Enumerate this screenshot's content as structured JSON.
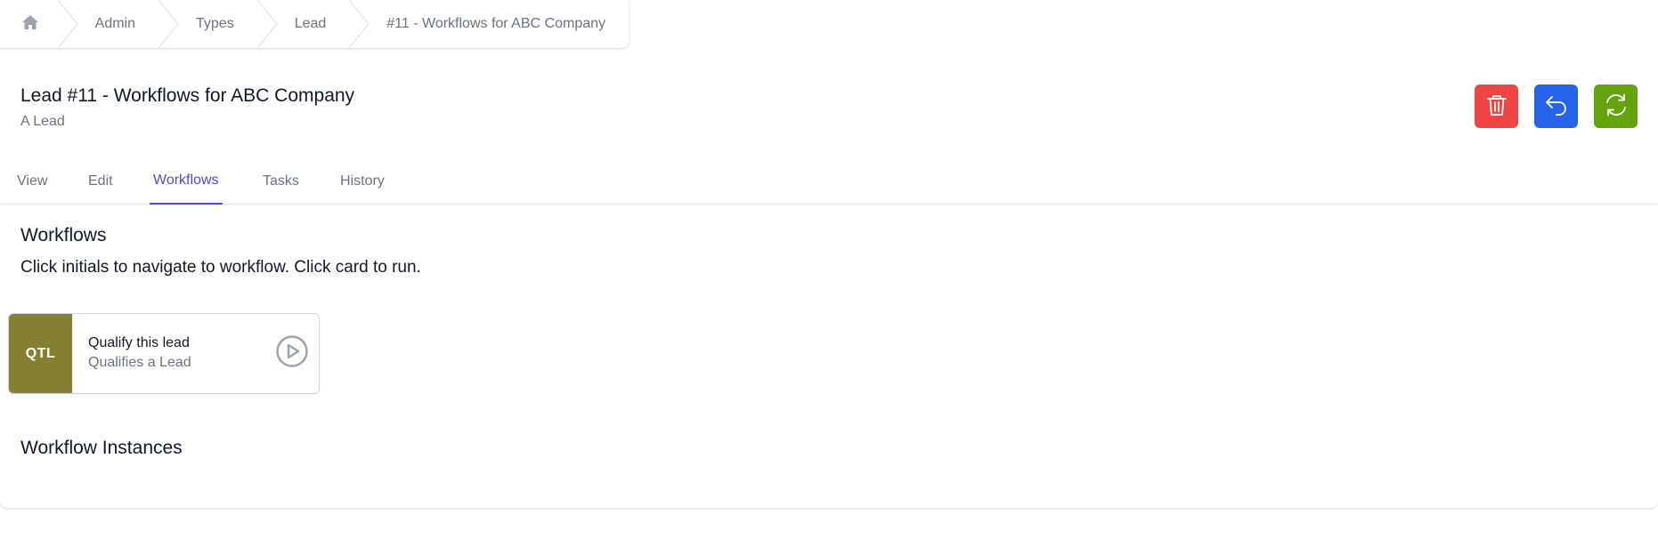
{
  "colors": {
    "delete": "#ef4444",
    "back": "#2563eb",
    "refresh": "#65a30d",
    "active_tab": "#4f46e5",
    "workflow_initials_bg": "#857f31"
  },
  "breadcrumb": {
    "home_icon": "home-icon",
    "items": [
      "Admin",
      "Types",
      "Lead",
      "#11 - Workflows for ABC Company"
    ]
  },
  "header": {
    "title": "Lead #11 - Workflows for ABC Company",
    "subtitle": "A Lead",
    "actions": [
      {
        "name": "delete",
        "icon": "trash-icon"
      },
      {
        "name": "back",
        "icon": "undo-icon"
      },
      {
        "name": "refresh",
        "icon": "refresh-icon"
      }
    ]
  },
  "tabs": [
    {
      "label": "View",
      "active": false
    },
    {
      "label": "Edit",
      "active": false
    },
    {
      "label": "Workflows",
      "active": true
    },
    {
      "label": "Tasks",
      "active": false
    },
    {
      "label": "History",
      "active": false
    }
  ],
  "workflows_section": {
    "title": "Workflows",
    "description": "Click initials to navigate to workflow. Click card to run.",
    "cards": [
      {
        "initials": "QTL",
        "name": "Qualify this lead",
        "description": "Qualifies a Lead",
        "run_icon": "play-circle-icon"
      }
    ]
  },
  "instances_section": {
    "title": "Workflow Instances"
  }
}
